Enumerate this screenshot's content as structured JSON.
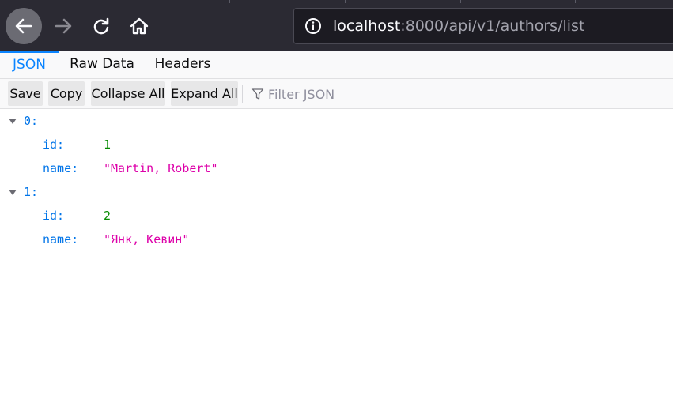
{
  "browser": {
    "url_host": "localhost",
    "url_path": ":8000/api/v1/authors/list",
    "icons": {
      "back": "arrow-left-icon",
      "forward": "arrow-right-icon",
      "reload": "reload-icon",
      "home": "home-icon",
      "site_info": "info-icon"
    }
  },
  "viewer": {
    "tabs": [
      {
        "label": "JSON",
        "selected": true
      },
      {
        "label": "Raw Data",
        "selected": false
      },
      {
        "label": "Headers",
        "selected": false
      }
    ],
    "toolbar": {
      "save_label": "Save",
      "copy_label": "Copy",
      "collapse_label": "Collapse All",
      "expand_label": "Expand All",
      "filter_placeholder": "Filter JSON"
    }
  },
  "json_tree": [
    {
      "key": "0:",
      "fields": [
        {
          "key": "id:",
          "value": "1",
          "type": "number"
        },
        {
          "key": "name:",
          "value": "\"Martin, Robert\"",
          "type": "string"
        }
      ]
    },
    {
      "key": "1:",
      "fields": [
        {
          "key": "id:",
          "value": "2",
          "type": "number"
        },
        {
          "key": "name:",
          "value": "\"Янк, Кевин\"",
          "type": "string"
        }
      ]
    }
  ],
  "colors": {
    "accent": "#0a84ff",
    "key": "#0074e8",
    "number": "#058b00",
    "string": "#dd00a9",
    "chrome": "#2b2a33"
  }
}
